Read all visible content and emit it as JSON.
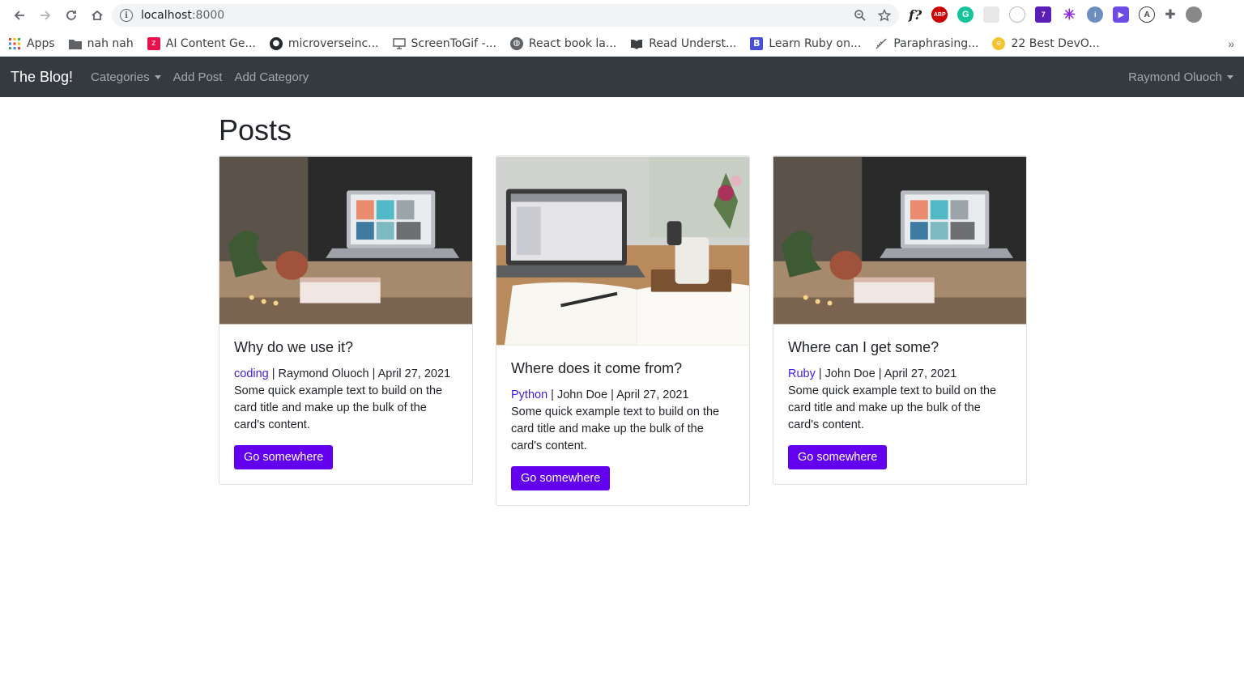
{
  "browser": {
    "url_host": "localhost",
    "url_port": ":8000",
    "bookmarks": [
      {
        "label": "Apps",
        "icon": "apps-grid-icon",
        "color": "#4285f4"
      },
      {
        "label": "nah nah",
        "icon": "folder-icon",
        "color": "#5f6368"
      },
      {
        "label": "AI Content Ge...",
        "icon": "zety-icon",
        "color": "#e8114b"
      },
      {
        "label": "microverseinc...",
        "icon": "github-icon",
        "color": "#24292e"
      },
      {
        "label": "ScreenToGif -...",
        "icon": "monitor-icon",
        "color": "#5f6368"
      },
      {
        "label": "React book la...",
        "icon": "globe-icon",
        "color": "#5f6368"
      },
      {
        "label": "Read Underst...",
        "icon": "book-icon",
        "color": "#3c4043"
      },
      {
        "label": "Learn Ruby on...",
        "icon": "b-logo-icon",
        "color": "#4a4fd9"
      },
      {
        "label": "Paraphrasing...",
        "icon": "quill-icon",
        "color": "#5f6368"
      },
      {
        "label": "22 Best DevO...",
        "icon": "devo-icon",
        "color": "#f4c430"
      }
    ],
    "more": "»"
  },
  "navbar": {
    "brand": "The Blog!",
    "categories": "Categories",
    "add_post": "Add Post",
    "add_category": "Add Category",
    "user": "Raymond Oluoch"
  },
  "main": {
    "title": "Posts",
    "posts": [
      {
        "title": "Why do we use it?",
        "category": "coding",
        "author": " | Raymond Oluoch | April 27, 2021",
        "text": "Some quick example text to build on the card title and make up the bulk of the card's content.",
        "button": "Go somewhere",
        "image": "laptop-desk-image"
      },
      {
        "title": "Where does it come from?",
        "category": "Python",
        "author": " | John Doe | April 27, 2021",
        "text": "Some quick example text to build on the card title and make up the bulk of the card's content.",
        "button": "Go somewhere",
        "image": "notebook-coffee-image"
      },
      {
        "title": "Where can I get some?",
        "category": "Ruby",
        "author": " | John Doe | April 27, 2021",
        "text": "Some quick example text to build on the card title and make up the bulk of the card's content.",
        "button": "Go somewhere",
        "image": "laptop-desk-image"
      }
    ]
  },
  "colors": {
    "navbar": "#343a40",
    "button": "#6200ee",
    "link": "#3b1fe4"
  }
}
